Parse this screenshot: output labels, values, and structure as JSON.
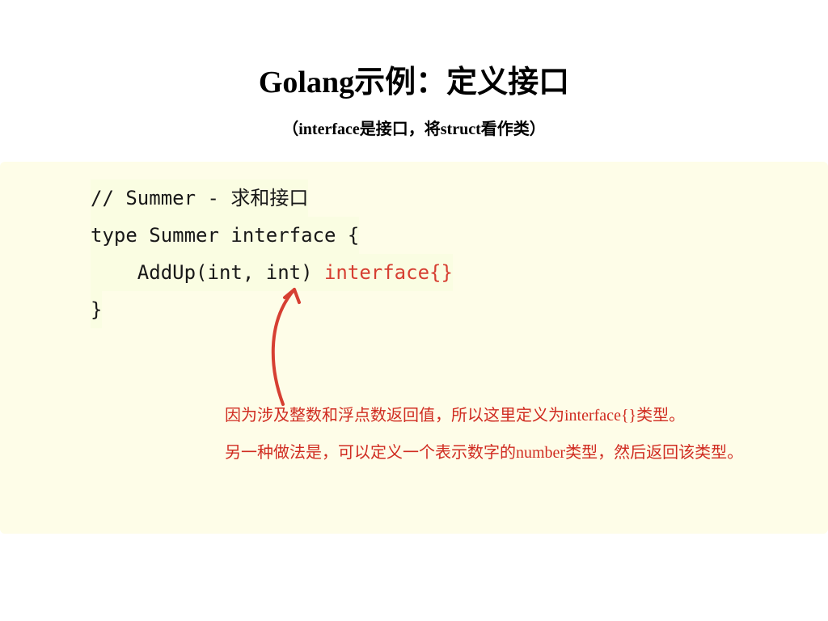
{
  "title": "Golang示例：定义接口",
  "subtitle": "（interface是接口，将struct看作类）",
  "code": {
    "l1": "// Summer - 求和接口",
    "l2": "type Summer interface {",
    "l3_prefix": "    AddUp(int, int) ",
    "l3_ret": "interface{}",
    "l4": "}"
  },
  "annotation": {
    "p1": "因为涉及整数和浮点数返回值，所以这里定义为interface{}类型。",
    "p2": "另一种做法是，可以定义一个表示数字的number类型，然后返回该类型。"
  },
  "colors": {
    "accent_red": "#d02c21",
    "code_bg": "#fefde8"
  }
}
